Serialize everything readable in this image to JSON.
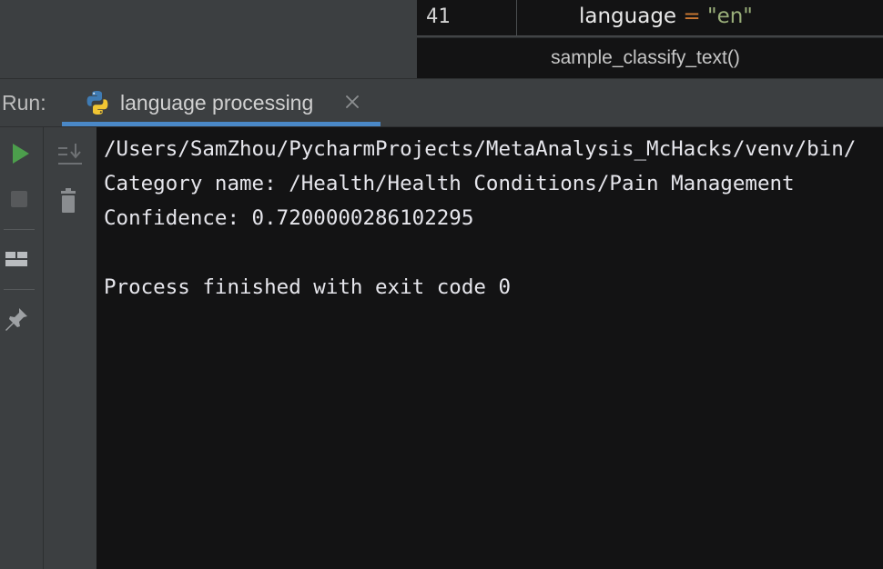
{
  "editor": {
    "line_number": "41",
    "code": {
      "identifier": "language",
      "operator": " = ",
      "string_literal": "\"en\""
    },
    "breadcrumb": "sample_classify_text()"
  },
  "run_window": {
    "label": "Run:",
    "tab": {
      "label": "language processing",
      "icon": "python-icon",
      "active": true
    }
  },
  "toolbar": {
    "left": [
      {
        "name": "rerun-button",
        "icon": "play-icon",
        "color": "#4c9e4c"
      },
      {
        "name": "stop-button",
        "icon": "stop-icon",
        "enabled": false
      },
      {
        "name": "layout-button",
        "icon": "layout-icon"
      },
      {
        "name": "pin-tab-button",
        "icon": "pin-icon"
      }
    ],
    "mid": [
      {
        "name": "scroll-to-end-button",
        "icon": "scroll-to-end-icon"
      },
      {
        "name": "clear-all-button",
        "icon": "trash-icon"
      }
    ]
  },
  "console": {
    "lines": [
      "/Users/SamZhou/PycharmProjects/MetaAnalysis_McHacks/venv/bin/",
      "Category name: /Health/Health Conditions/Pain Management",
      "Confidence: 0.7200000286102295",
      "",
      "Process finished with exit code 0"
    ]
  },
  "colors": {
    "console_background": "#131314",
    "panel_background": "#3c3f41",
    "tab_underline": "#4a88c7",
    "keyword_operator": "#cc7832",
    "string_literal": "#9aaf7a"
  }
}
